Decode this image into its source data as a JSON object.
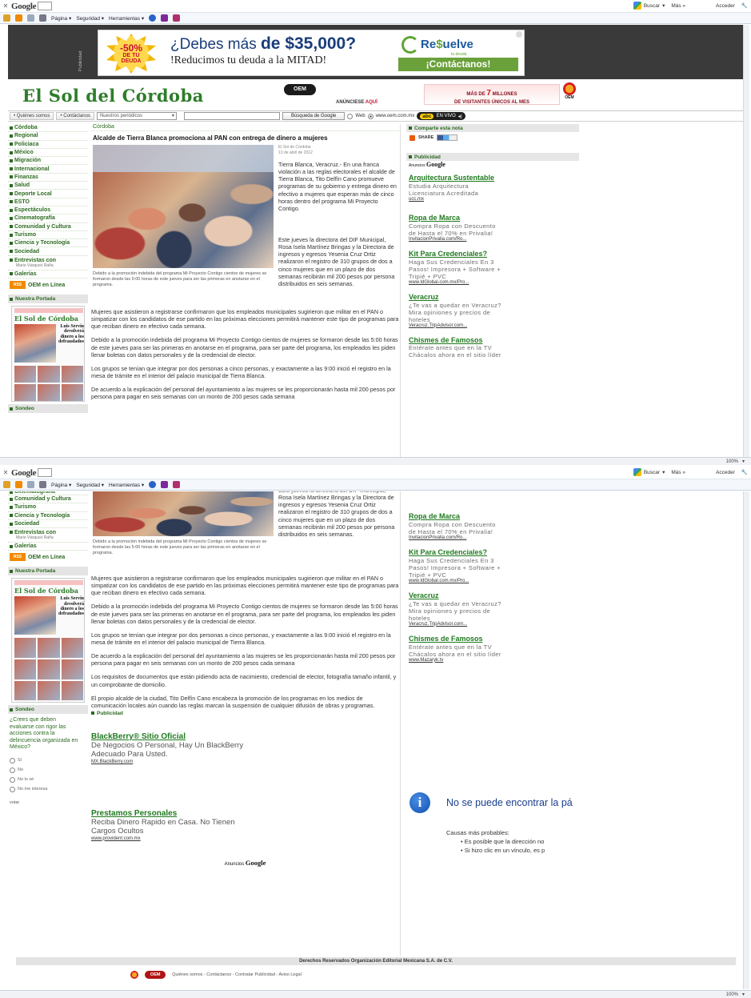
{
  "browser": {
    "google_label": "Google",
    "buscar": "Buscar",
    "mas": "Más »",
    "acceder": "Acceder",
    "toolbar": [
      "Página ▾",
      "Seguridad ▾",
      "Herramientas ▾"
    ],
    "zoom": "100%"
  },
  "ad_banner": {
    "publicidad": "Publicidad",
    "burst_top": "-50%",
    "burst_mid": "DE TU",
    "burst_bot": "DEUDA",
    "line1_pre": "¿Debes más ",
    "line1_bold": "de $35,000?",
    "line2": "!Reducimos tu deuda a la MITAD!",
    "brand_re": "Re",
    "brand_s": "$",
    "brand_rest": "uelve",
    "brand_sub": "tu deuda",
    "cta": "¡Contáctanos!"
  },
  "masthead": {
    "title": "El Sol del Córdoba",
    "oem_logo": "OEM",
    "anunciese": "ANÚNCIESE",
    "aqui": "AQUÍ",
    "millones_pre": "MÁS DE",
    "millones_num": "7",
    "millones_post": "MILLONES",
    "millones_line2": "DE VISITANTES ÚNICOS AL MES",
    "oem_small": "OEM"
  },
  "nav": {
    "quienes": "• Quiénes somos",
    "contactanos": "• Contáctanos",
    "periodicos": "Nuestros periódicos",
    "busqueda": "Búsqueda de Google",
    "web": "Web",
    "oem_site": "www.oem.com.mx",
    "abc": "abc",
    "en_vivo": "EN VIVO"
  },
  "sidebar": {
    "items": [
      "Córdoba",
      "Regional",
      "Policiaca",
      "México",
      "Migración",
      "Internacional",
      "Finanzas",
      "Salud",
      "Deporte Local",
      "ESTO",
      "Espectáculos",
      "Cinematografía",
      "Comunidad y Cultura",
      "Turismo",
      "Ciencia y Tecnología",
      "Sociedad"
    ],
    "entrevistas": "Entrevistas con",
    "entrevistas_sub": "Mario Vásquez Raña",
    "galerias": "Galerías",
    "rss": "RSS",
    "oem_linea": "OEM en Línea",
    "nuestra_portada": "Nuestra Portada",
    "portada_logo": "El Sol de Córdoba",
    "portada_headline": "Luis Servín devolverá dinero a los defraudados",
    "sondeo": "Sondeo"
  },
  "article": {
    "crumb": "Córdoba",
    "headline": "Alcalde de Tierra Blanca promociona al PAN con entrega de dinero a mujeres",
    "byline_source": "El Sol de Córdoba",
    "byline_date": "13 de abril de 2012",
    "caption": "Debido a la promoción indebida del programa Mi Proyecto Contigo cientos de mujeres se formaron desde las 5:00 horas de este jueves para ser las primeras en anotarse en el programa.",
    "p1": "Tierra Blanca, Veracruz.- En una franca violación a las reglas electorales el alcalde de Tierra Blanca, Tito Delfín Cano promueve programas de su gobierno y entrega dinero en efectivo a mujeres que esperan más de cinco horas dentro del programa Mi Proyecto Contigo.",
    "p2": "Este jueves la directora del DIF Municipal, Rosa Isela Martínez Bringas y la Directora de ingresos y egresos Yesenia Cruz Ortiz realizaron el registro de 310 grupos de dos a cinco mujeres que en un plazo de dos semanas recibirán mil 200 pesos por persona distribuidos en seis semanas.",
    "p3": "Mujeres que asistieron a registrarse confirmaron que los empleados municipales sugirieron que militar en el PAN o simpatizar con los candidatos de ese partido en las próximas elecciones permitirá mantener este tipo de programas para que reciban dinero en efectivo cada semana.",
    "p4": "Debido a la promoción indebida del programa Mi Proyecto Contigo cientos de mujeres se formaron desde las 5:00 horas de este jueves para ser las primeras en anotarse en el programa, para ser parte del programa, los empleados les piden llenar boletas con datos personales y de la credencial de elector.",
    "p5": "Los grupos se tenían que integrar por dos personas a cinco personas, y exactamente a las 9:00 inició el registro en la mesa de trámite en el interior del palacio municipal de Tierra Blanca.",
    "p6": "De acuerdo a la explicación del personal del ayuntamiento a las mujeres se les proporcionarán hasta mil 200 pesos por persona para pagar en seis semanas con un monto de 200 pesos cada semana",
    "p7": "Los requisitos de documentos que están pidiendo acta de nacimiento, credencial de elector, fotografía tamaño infantil, y un comprobante de domicilio.",
    "p8": "El propio alcalde de la ciudad, Tito Delfín Cano encabeza la promoción de los programas en los medios de comunicación locales aún cuando las reglas marcan la suspensión de cualquier difusión de obras y programas.",
    "publicidad": "Publicidad",
    "ads": [
      {
        "title": "BlackBerry® Sitio Oficial",
        "desc": "De Negocios O Personal, Hay Un BlackBerry Adecuado Para Usted.",
        "url": "MX.BlackBerry.com"
      },
      {
        "title": "Prestamos Personales",
        "desc": "Reciba Dinero Rapido en Casa. No Tienen Cargos Ocultos",
        "url": "www.provident.com.mx"
      }
    ],
    "anuncios": "Anuncios",
    "google": "Google"
  },
  "right": {
    "comparte": "Comparte esta nota",
    "share": "SHARE",
    "publicidad": "Publicidad",
    "anuncios": "Anuncios",
    "google": "Google",
    "ads": [
      {
        "title": "Arquitectura Sustentable",
        "desc": "Estudia Arquitectura Licenciatura Acreditada",
        "url": "ucc.mx"
      },
      {
        "title": "Ropa de Marca",
        "desc": "Compra Ropa con Descuento de Hasta el 70% en Privalia!",
        "url": "InvitacionPrivalia.com/Ro..."
      },
      {
        "title": "Kit Para Credenciales?",
        "desc": "Haga Sus Credenciales En 3 Pasos! Impresora + Software + Tripié + PVC",
        "url": "www.IdGlobal.com.mx/Pro..."
      },
      {
        "title": "Veracruz",
        "desc": "¿Te vas a quedar en Veracruz? Mira opiniones y precios de hoteles",
        "url": "Veracruz.TripAdvisor.com..."
      },
      {
        "title": "Chismes de Famosos",
        "desc": "Entérate antes que en la TV Chácalos ahora en el sitio líder",
        "url": "www.Mazaryk.tv"
      }
    ]
  },
  "poll": {
    "question": "¿Crees que deben evaluarse con rigor las acciones contra la delincuencia organizada en México?",
    "options": [
      "Sí",
      "No",
      "No lo sé",
      "No me interesa"
    ],
    "votar": "votar"
  },
  "error": {
    "title": "No se puede encontrar la pá",
    "causas": "Causas más probables:",
    "c1": "Es posible que la dirección no",
    "c2": "Si hizo clic en un vínculo, es p"
  },
  "footer": {
    "rights": "Derechos Reservados Organización Editorial Mexicana S.A. de C.V.",
    "oem": "OEM",
    "links": "Quiénes somos - Contáctanos - Contratar Publicidad - Aviso Legal"
  }
}
